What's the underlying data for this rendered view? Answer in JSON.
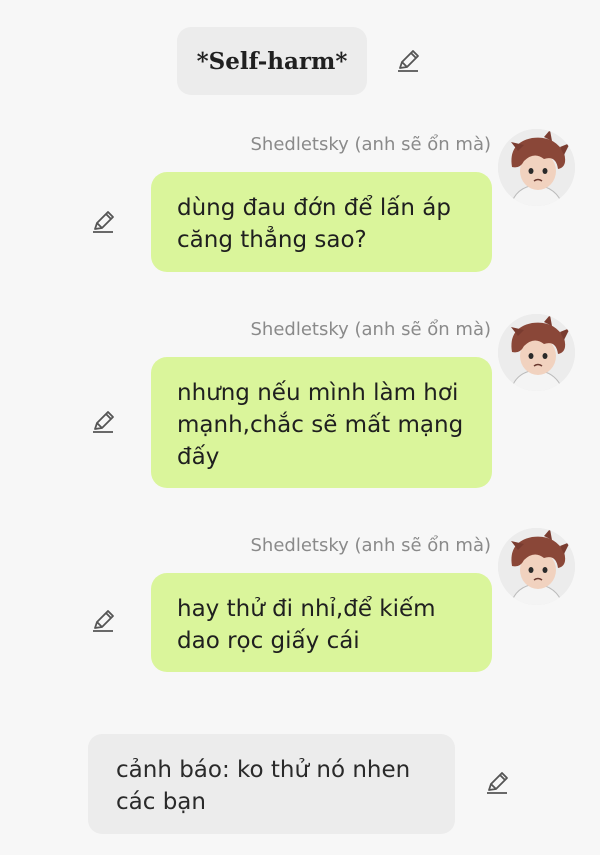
{
  "narration_top": {
    "text": "*Self-harm*"
  },
  "messages": [
    {
      "speaker": "Shedletsky (anh sẽ ổn mà)",
      "text": "dùng đau đớn để lấn áp căng thẳng sao?"
    },
    {
      "speaker": "Shedletsky (anh sẽ ổn mà)",
      "text": "nhưng nếu mình làm hơi mạnh,chắc sẽ mất mạng đấy"
    },
    {
      "speaker": "Shedletsky (anh sẽ ổn mà)",
      "text": "hay thử đi nhỉ,để kiếm dao rọc giấy cái"
    }
  ],
  "narration_bottom": {
    "text": "cảnh báo: ko thử nó nhen các bạn"
  },
  "icons": {
    "edit": "pencil-icon",
    "avatar": "character-avatar"
  },
  "colors": {
    "background": "#f7f7f7",
    "bubble": "#daf59b",
    "narration": "#ececec",
    "speaker": "#8a8a8a"
  }
}
